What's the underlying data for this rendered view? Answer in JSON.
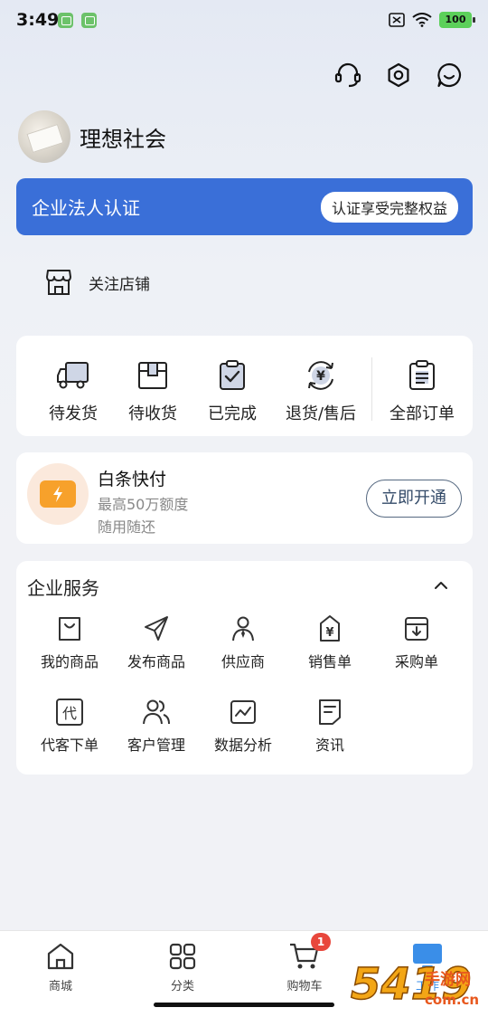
{
  "status_bar": {
    "time": "3:49",
    "battery": "100"
  },
  "profile": {
    "name": "理想社会"
  },
  "certification": {
    "title": "企业法人认证",
    "action": "认证享受完整权益"
  },
  "follow": {
    "label": "关注店铺"
  },
  "orders": [
    {
      "label": "待发货",
      "icon": "truck-icon"
    },
    {
      "label": "待收货",
      "icon": "package-icon"
    },
    {
      "label": "已完成",
      "icon": "clipboard-check-icon"
    },
    {
      "label": "退货/售后",
      "icon": "refund-icon"
    },
    {
      "label": "全部订单",
      "icon": "order-list-icon"
    }
  ],
  "payment": {
    "title": "白条快付",
    "subtitle": "最高50万额度",
    "note": "随用随还",
    "button": "立即开通"
  },
  "services": {
    "title": "企业服务",
    "items": [
      {
        "label": "我的商品",
        "icon": "shopping-bag-icon"
      },
      {
        "label": "发布商品",
        "icon": "send-icon"
      },
      {
        "label": "供应商",
        "icon": "supplier-icon"
      },
      {
        "label": "销售单",
        "icon": "sales-tag-icon"
      },
      {
        "label": "采购单",
        "icon": "purchase-box-icon"
      },
      {
        "label": "代客下单",
        "icon": "proxy-order-icon",
        "glyph": "代"
      },
      {
        "label": "客户管理",
        "icon": "customers-icon"
      },
      {
        "label": "数据分析",
        "icon": "chart-icon"
      },
      {
        "label": "资讯",
        "icon": "news-icon"
      }
    ]
  },
  "tabbar": {
    "items": [
      {
        "label": "商城",
        "icon": "home-icon"
      },
      {
        "label": "分类",
        "icon": "grid-icon"
      },
      {
        "label": "购物车",
        "icon": "cart-icon",
        "badge": "1"
      },
      {
        "label": "工作",
        "icon": "monitor-icon",
        "active": true
      }
    ]
  },
  "colors": {
    "accent": "#3a6fd8",
    "badge": "#e8473c",
    "pay_orange": "#f7a12b"
  },
  "watermark": {
    "number": "5419",
    "name": "手游网",
    "domain": "com.cn"
  }
}
